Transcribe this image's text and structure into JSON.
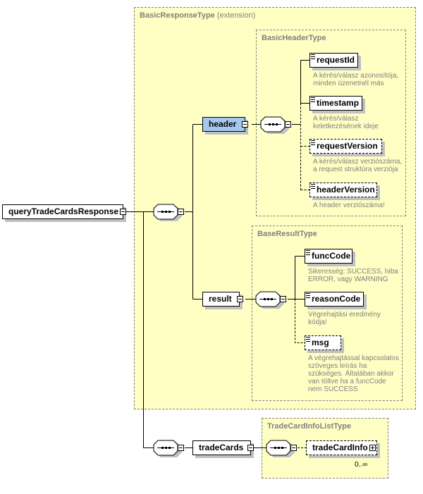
{
  "types": {
    "basic_response": {
      "name": "BasicResponseType",
      "qualifier": "(extension)"
    },
    "basic_header": {
      "name": "BasicHeaderType"
    },
    "base_result": {
      "name": "BaseResultType"
    },
    "trade_card_list": {
      "name": "TradeCardInfoListType"
    }
  },
  "root": {
    "name": "queryTradeCardsResponse"
  },
  "header": {
    "name": "header",
    "children": [
      {
        "name": "requestId",
        "optional": false,
        "doc": "A kérés/válasz azonosítója, minden üzenetnél más",
        "doc_lines": [
          "A kérés/válasz azonosítója,",
          "minden üzenetnél más"
        ]
      },
      {
        "name": "timestamp",
        "optional": false,
        "doc_lines": [
          "A kérés/válasz",
          "keletkezésének ideje"
        ]
      },
      {
        "name": "requestVersion",
        "optional": true,
        "doc_lines": [
          "A kérés/válasz verziószáma,",
          "a request struktúra verziója"
        ]
      },
      {
        "name": "headerVersion",
        "optional": true,
        "doc_lines": [
          "A header verziószáma!"
        ]
      }
    ]
  },
  "result": {
    "name": "result",
    "children": [
      {
        "name": "funcCode",
        "optional": false,
        "doc_lines": [
          "Sikeresség: SUCCESS, hiba",
          "ERROR, vagy WARNING"
        ]
      },
      {
        "name": "reasonCode",
        "optional": false,
        "doc_lines": [
          "Végrehajtási eredmény",
          "kódja!"
        ]
      },
      {
        "name": "msg",
        "optional": true,
        "doc_lines": [
          "A végrehajtással kapcsolatos",
          "szöveges leírás ha",
          "szükséges. Általában akkor",
          "van töltve ha a funcCode",
          "nem SUCCESS"
        ]
      }
    ]
  },
  "trade_cards": {
    "name": "tradeCards",
    "child": {
      "name": "tradeCardInfo",
      "optional": true,
      "occurrence": "0..∞"
    }
  },
  "colors": {
    "type_fill": "#ffffc4",
    "selected_element": "#a5c8ef",
    "shadow": "#c0c0c0",
    "doc_text": "#808080"
  }
}
